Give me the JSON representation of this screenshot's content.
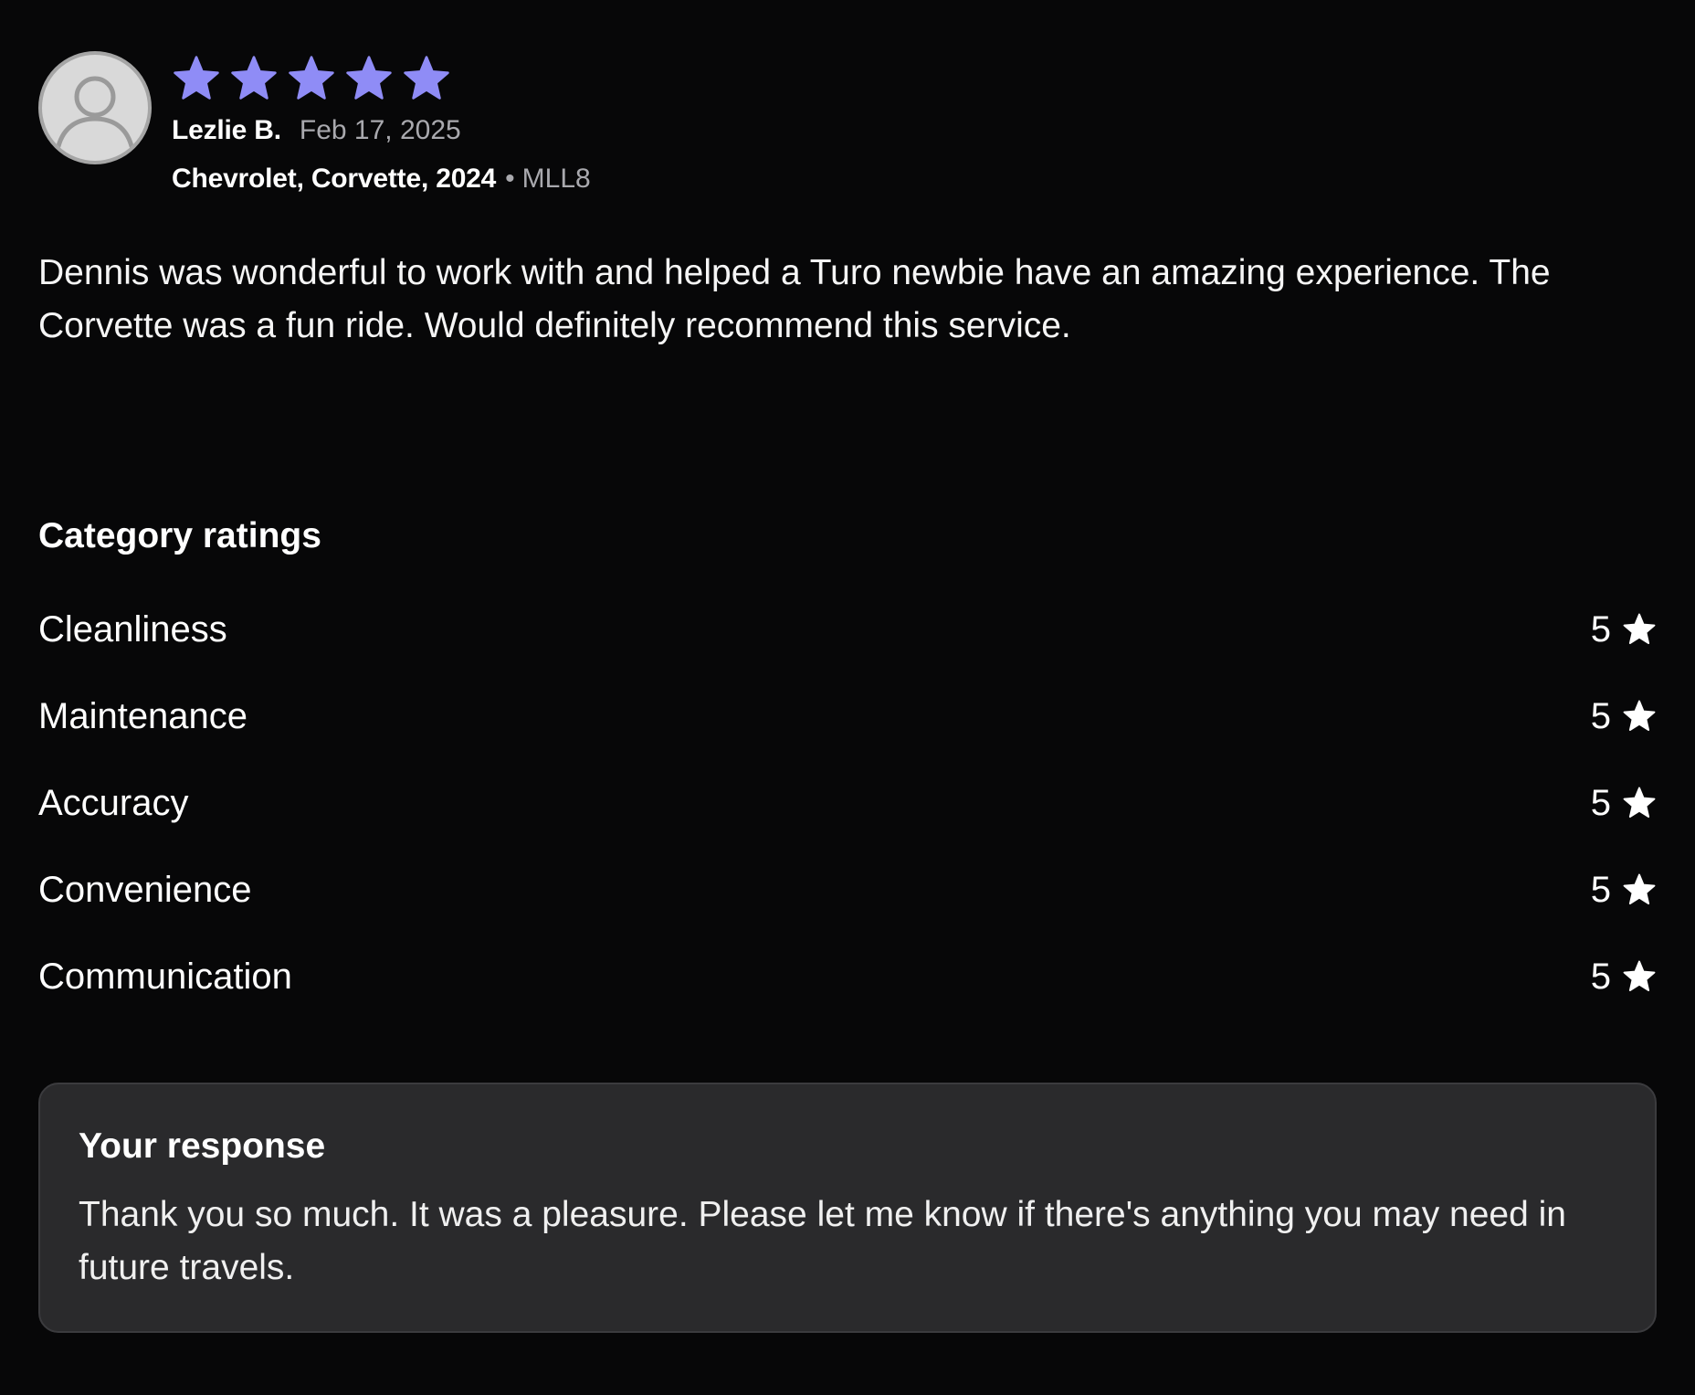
{
  "review": {
    "rating": 5,
    "max_rating": 5,
    "star_color": "#8f8cf6",
    "reviewer_name": "Lezlie B.",
    "date": "Feb 17, 2025",
    "vehicle": "Chevrolet, Corvette, 2024",
    "separator": "•",
    "plate": "MLL8",
    "avatar_icon": "user-silhouette-icon",
    "text": "Dennis was wonderful to work with and helped a Turo newbie have an amazing experience. The Corvette was a fun ride. Would definitely recommend this service."
  },
  "category_ratings": {
    "title": "Category ratings",
    "star_icon": "star-icon",
    "items": [
      {
        "label": "Cleanliness",
        "score": "5"
      },
      {
        "label": "Maintenance",
        "score": "5"
      },
      {
        "label": "Accuracy",
        "score": "5"
      },
      {
        "label": "Convenience",
        "score": "5"
      },
      {
        "label": "Communication",
        "score": "5"
      }
    ]
  },
  "response": {
    "title": "Your response",
    "text": "Thank you so much. It was a pleasure. Please let me know if there's anything you may need in future travels."
  }
}
